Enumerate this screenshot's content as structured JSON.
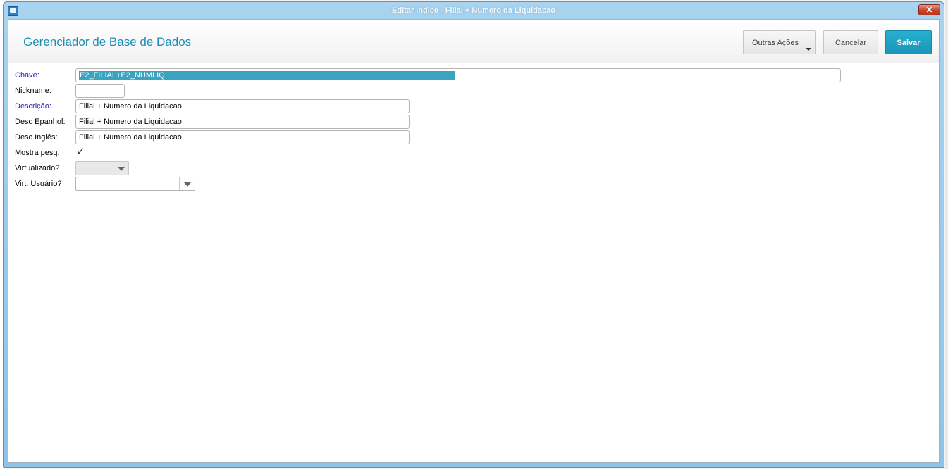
{
  "window": {
    "title": "Editar Índice - Filial + Numero da Liquidacao",
    "close_label": "✕"
  },
  "header": {
    "title": "Gerenciador de Base de Dados",
    "outras_acoes_label": "Outras Ações",
    "cancel_label": "Cancelar",
    "save_label": "Salvar"
  },
  "form": {
    "chave": {
      "label": "Chave:",
      "value": "E2_FILIAL+E2_NUMLIQ"
    },
    "nickname": {
      "label": "Nickname:",
      "value": ""
    },
    "descricao": {
      "label": "Descrição:",
      "value": "Filial + Numero da Liquidacao"
    },
    "desc_espanhol": {
      "label": "Desc Epanhol:",
      "value": "Filial + Numero da Liquidacao"
    },
    "desc_ingles": {
      "label": "Desc Inglês:",
      "value": "Filial + Numero da Liquidacao"
    },
    "mostra_pesq": {
      "label": "Mostra pesq.",
      "checked": true,
      "check_glyph": "✓"
    },
    "virtualizado": {
      "label": "Virtualizado?",
      "value": ""
    },
    "virt_usuario": {
      "label": "Virt. Usuário?",
      "value": ""
    }
  },
  "colors": {
    "accent": "#1a8fb4",
    "save_button": "#1a96b8",
    "required_label": "#1f1fb0",
    "selection": "#3aa3bf"
  }
}
